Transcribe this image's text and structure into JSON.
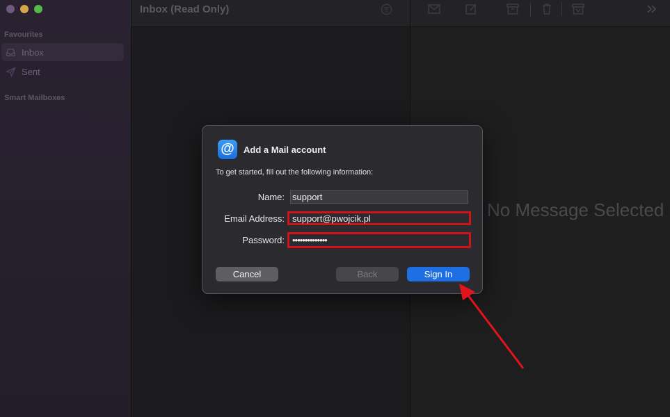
{
  "window": {
    "title": "Inbox (Read Only)"
  },
  "sidebar": {
    "favourites_label": "Favourites",
    "items": [
      {
        "label": "Inbox",
        "icon": "inbox-icon",
        "selected": true
      },
      {
        "label": "Sent",
        "icon": "paper-plane-icon",
        "selected": false
      }
    ],
    "smart_mailboxes_label": "Smart Mailboxes"
  },
  "message_pane": {
    "empty_text": "No Message Selected"
  },
  "dialog": {
    "icon_glyph": "@",
    "title": "Add a Mail account",
    "subtitle": "To get started, fill out the following information:",
    "fields": {
      "name_label": "Name:",
      "name_value": "support",
      "email_label": "Email Address:",
      "email_value": "support@pwojcik.pl",
      "password_label": "Password:",
      "password_value": "••••••••••••••"
    },
    "buttons": {
      "cancel": "Cancel",
      "back": "Back",
      "sign_in": "Sign In"
    }
  },
  "colors": {
    "accent": "#1d6fe2",
    "highlight": "#d0131b",
    "annotation_arrow": "#e0141c"
  }
}
